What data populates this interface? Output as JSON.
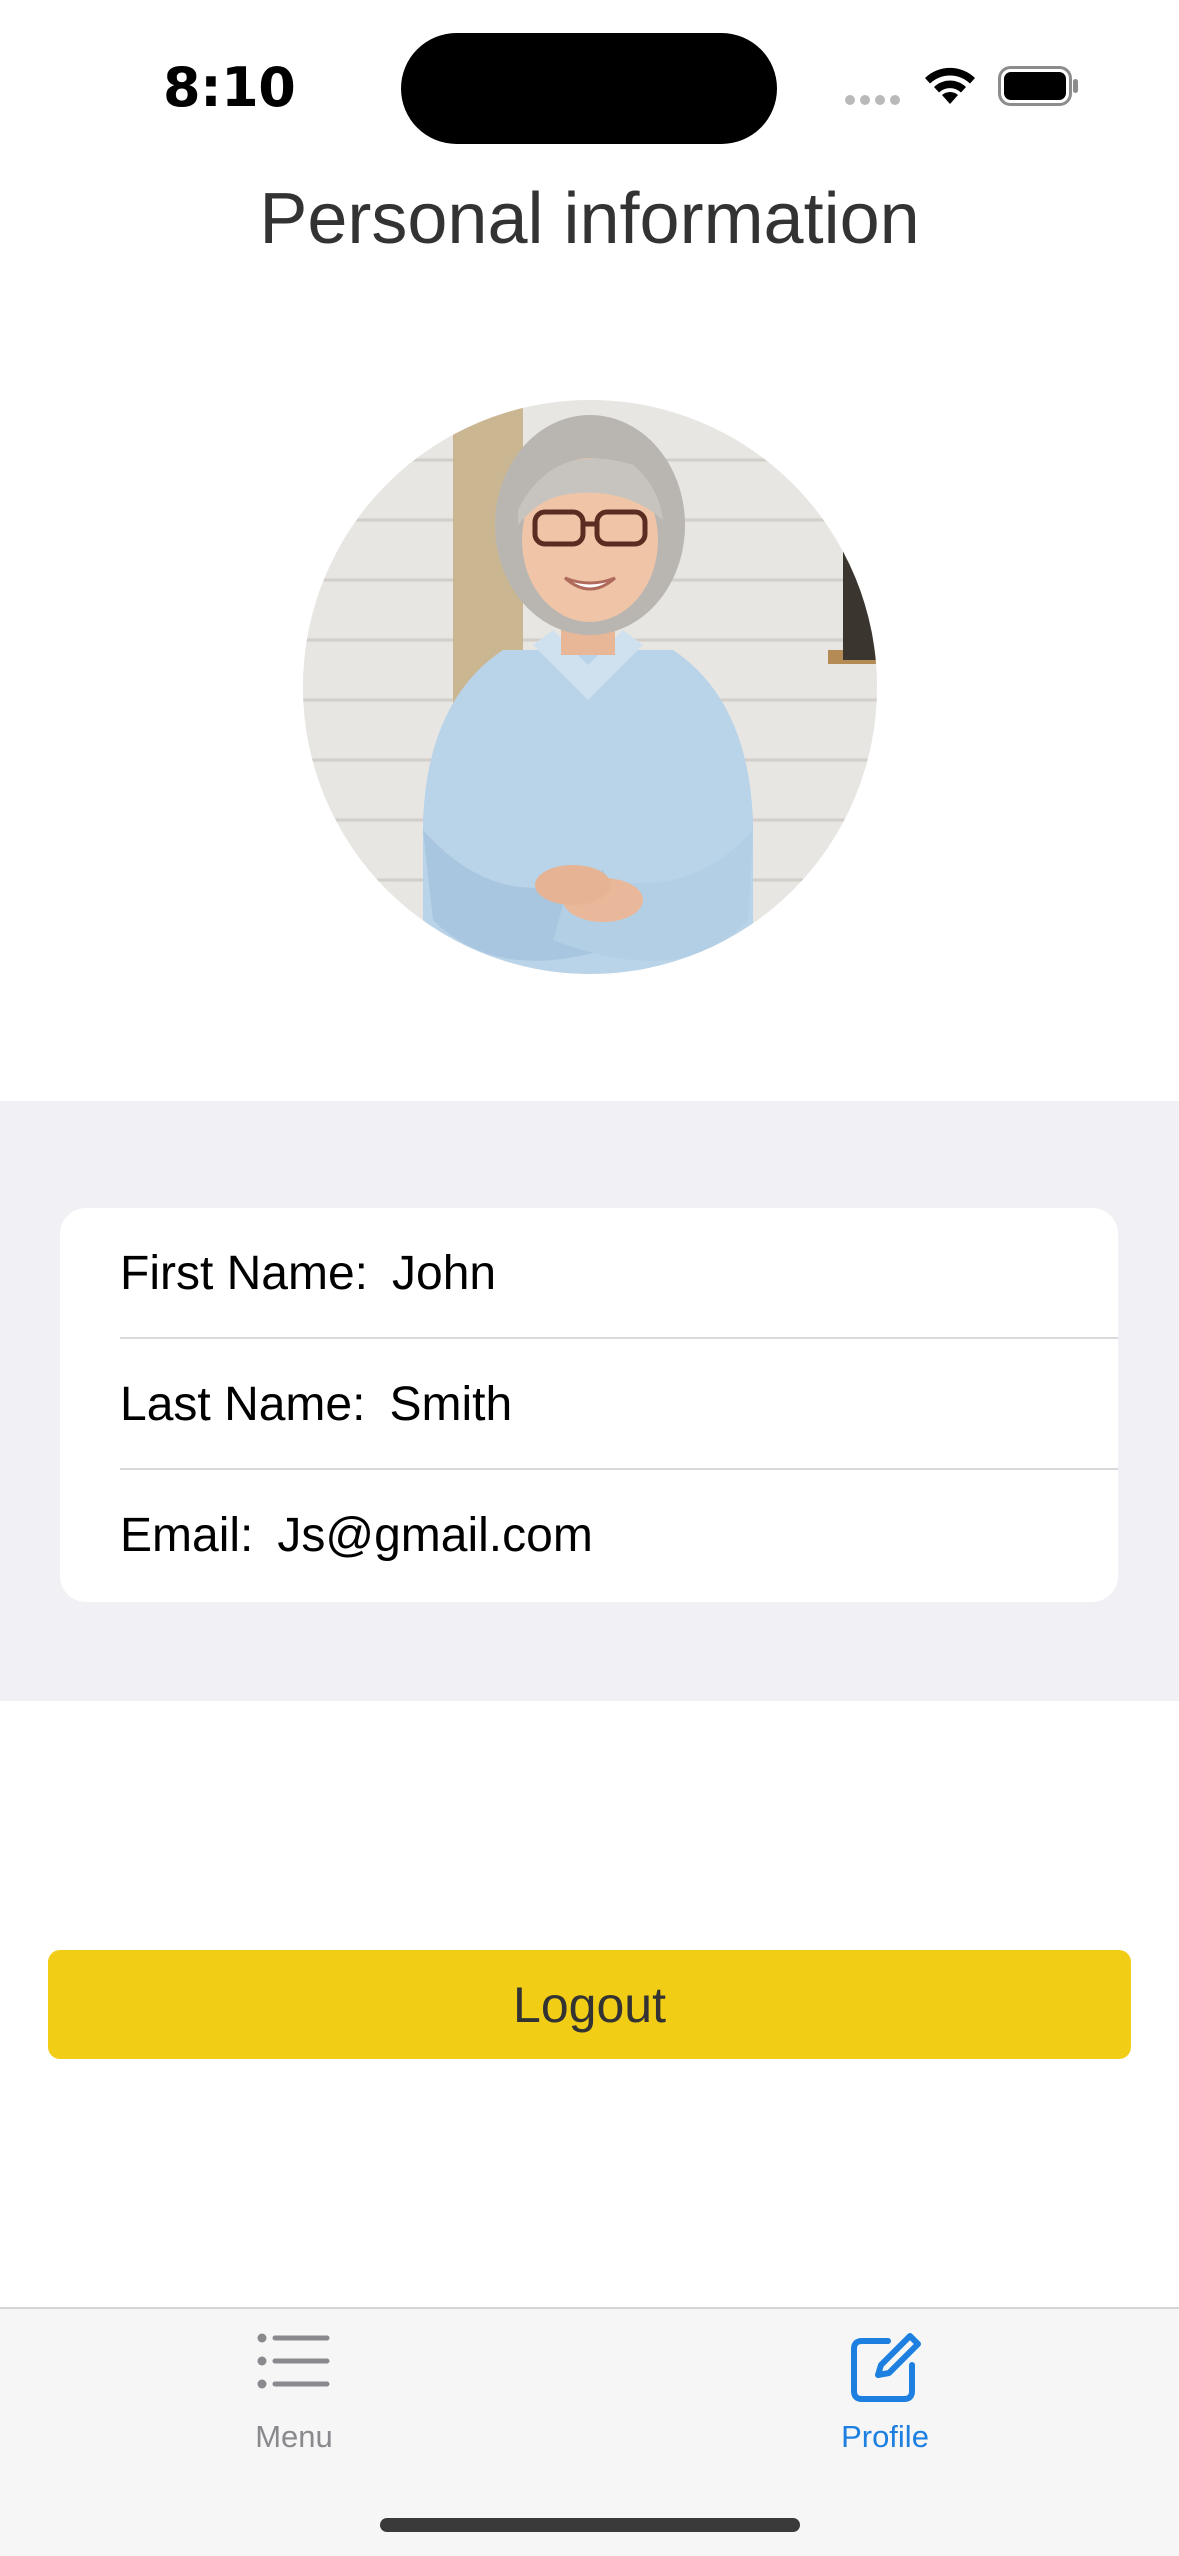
{
  "status_bar": {
    "time": "8:10"
  },
  "page": {
    "title": "Personal information"
  },
  "profile": {
    "first_name_label": "First Name:",
    "first_name_value": "John",
    "last_name_label": "Last Name:",
    "last_name_value": "Smith",
    "email_label": "Email:",
    "email_value": "Js@gmail.com"
  },
  "actions": {
    "logout_label": "Logout"
  },
  "tab_bar": {
    "tabs": [
      {
        "label": "Menu",
        "icon": "list-icon",
        "active": false
      },
      {
        "label": "Profile",
        "icon": "edit-icon",
        "active": true
      }
    ]
  },
  "colors": {
    "accent_yellow": "#f2cd16",
    "active_tab_blue": "#1d7fe0",
    "inactive_tab_gray": "#8a8a8e",
    "section_background": "#f1f1f5"
  }
}
